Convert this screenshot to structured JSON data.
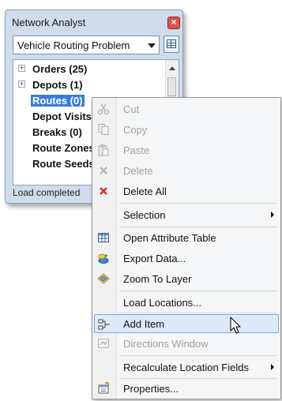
{
  "window": {
    "title": "Network Analyst",
    "layer_select_value": "Vehicle Routing Problem",
    "status_text": "Load completed"
  },
  "tree": {
    "items": [
      {
        "label": "Orders (25)",
        "expander": "+"
      },
      {
        "label": "Depots (1)",
        "expander": "+"
      },
      {
        "label": "Routes (0)",
        "selected": true
      },
      {
        "label": "Depot Visits"
      },
      {
        "label": "Breaks (0)"
      },
      {
        "label": "Route Zones"
      },
      {
        "label": "Route Seeds"
      }
    ]
  },
  "context_menu": {
    "items": [
      {
        "label": "Cut",
        "icon": "scissors-icon",
        "enabled": false
      },
      {
        "label": "Copy",
        "icon": "copy-icon",
        "enabled": false
      },
      {
        "label": "Paste",
        "icon": "paste-icon",
        "enabled": false
      },
      {
        "label": "Delete",
        "icon": "delete-x-icon",
        "enabled": false
      },
      {
        "label": "Delete All",
        "icon": "delete-all-icon",
        "enabled": true
      },
      {
        "label": "Selection",
        "enabled": true,
        "submenu": true
      },
      {
        "label": "Open Attribute Table",
        "icon": "table-icon",
        "enabled": true
      },
      {
        "label": "Export Data...",
        "icon": "export-icon",
        "enabled": true
      },
      {
        "label": "Zoom To Layer",
        "icon": "zoom-layer-icon",
        "enabled": true
      },
      {
        "label": "Load Locations...",
        "enabled": true
      },
      {
        "label": "Add Item",
        "icon": "add-item-icon",
        "enabled": true,
        "hovered": true
      },
      {
        "label": "Directions Window",
        "icon": "directions-icon",
        "enabled": false
      },
      {
        "label": "Recalculate Location Fields",
        "enabled": true,
        "submenu": true
      },
      {
        "label": "Properties...",
        "icon": "properties-icon",
        "enabled": true
      }
    ]
  },
  "colors": {
    "selection_blue": "#3a7bd5",
    "hover_fill": "#dce9f9",
    "delete_red": "#d32f2f"
  }
}
